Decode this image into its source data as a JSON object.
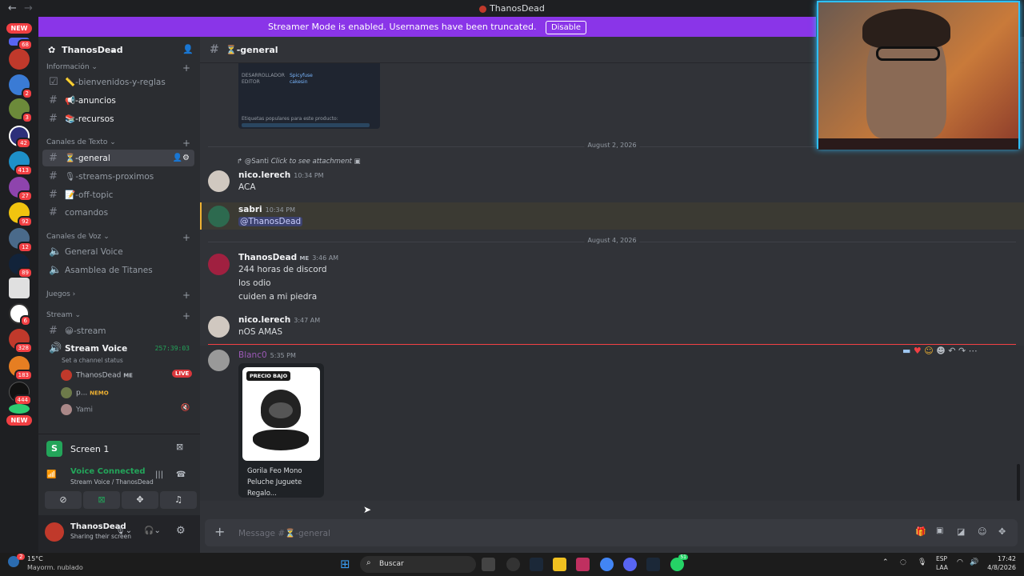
{
  "titlebar": {
    "title": "ThanosDead"
  },
  "banner": {
    "text": "Streamer Mode is enabled. Usernames have been truncated.",
    "button": "Disable"
  },
  "guilds": {
    "new_top": "NEW",
    "new_bottom": "NEW",
    "badges": [
      "68",
      "2",
      "3",
      "42",
      "413",
      "27",
      "92",
      "12",
      "89",
      "6",
      "328",
      "183",
      "444"
    ]
  },
  "server": {
    "name": "ThanosDead"
  },
  "categories": {
    "info": "Información",
    "text": "Canales de Texto",
    "voice": "Canales de Voz",
    "games": "Juegos",
    "stream": "Stream"
  },
  "channels": {
    "bienvenidos": "📏-bienvenidos-y-reglas",
    "anuncios": "📢-anuncios",
    "recursos": "📚-recursos",
    "general": "⏳-general",
    "streams_proximos": "🎙-streams-proximos",
    "off_topic": "📝-off-topic",
    "comandos": "comandos",
    "general_voice": "General Voice",
    "asamblea": "Asamblea de Titanes",
    "stream_text": "😀-stream",
    "stream_voice": "Stream Voice",
    "stream_timer": "257:39:03",
    "channel_status": "Set a channel status"
  },
  "voice_users": [
    {
      "name": "ThanosDead",
      "tag": "ME",
      "live": "LIVE"
    },
    {
      "name": "p...",
      "tag": "NEMO"
    },
    {
      "name": "Yami"
    }
  ],
  "screen": {
    "label": "Screen 1"
  },
  "voice": {
    "status": "Voice Connected",
    "location": "Stream Voice / ThanosDead"
  },
  "user": {
    "name": "ThanosDead",
    "status": "Sharing their screen"
  },
  "header": {
    "channel": "⏳-general"
  },
  "embed_top": {
    "row1k": "DESARROLLADOR",
    "row1v": "Spicyfuse",
    "row2k": "EDITOR",
    "row2v": "cakesin",
    "tags": "Etiquetas populares para este producto:"
  },
  "dates": {
    "d1": "August 2, 2026",
    "d2": "August 4, 2026"
  },
  "messages": {
    "reply": {
      "user": "@Santi",
      "text": "Click to see attachment"
    },
    "m1": {
      "name": "nico.lerech",
      "time": "10:34 PM",
      "text": "ACA"
    },
    "m2": {
      "name": "sabri",
      "time": "10:34 PM",
      "text": "@ThanosDead"
    },
    "m3": {
      "name": "ThanosDead",
      "tag": "ME",
      "time": "3:46 AM",
      "lines": [
        "244 horas de discord",
        "los odio",
        "cuiden a mi piedra"
      ]
    },
    "m4": {
      "name": "nico.lerech",
      "time": "3:47 AM",
      "text": "nOS AMAS"
    },
    "m5": {
      "name": "Blanc0",
      "time": "5:35 PM",
      "card_badge": "PRECIO BAJO",
      "card_title": "Gorila Feo Mono Peluche Juguete Regalo..."
    }
  },
  "composer": {
    "placeholder": "Message #⏳-general"
  },
  "taskbar": {
    "temp": "15°C",
    "weather": "Mayorm. nublado",
    "weather_badge": "2",
    "search": "Buscar",
    "lang": "ESP",
    "lang2": "LAA",
    "time": "17:42",
    "date": "4/8/2026",
    "wa_badge": "51"
  }
}
